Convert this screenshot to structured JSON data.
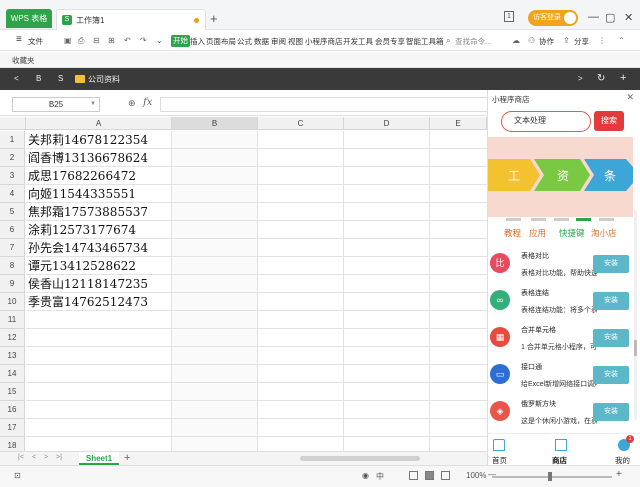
{
  "titlebar": {
    "wps_tab": "WPS 表格",
    "doc_tab": "工作簿1",
    "doc_icon": "S",
    "new_tab": "+",
    "layout_icon": "1",
    "login": "访客登录",
    "minimize": "—",
    "restore": "▢",
    "close": "✕"
  },
  "menubar": {
    "hamburger": "≡",
    "file": "文件",
    "items": [
      "开始",
      "插入",
      "页面布局",
      "公式",
      "数据",
      "审阅",
      "视图",
      "小程序商店",
      "开发工具",
      "会员专享",
      "智能工具箱"
    ],
    "search": "查找命令...",
    "collab": "协作",
    "share": "分享"
  },
  "favbar": {
    "label": "收藏夹"
  },
  "cloudbar": {
    "back": "<",
    "b": "B",
    "s": "S",
    "folder": "公司资料",
    "forward": ">",
    "refresh": "↻",
    "add": "+"
  },
  "formulabar": {
    "cell_ref": "B25",
    "fx": "fx"
  },
  "grid": {
    "columns": [
      "A",
      "B",
      "C",
      "D",
      "E"
    ],
    "rows": [
      "1",
      "2",
      "3",
      "4",
      "5",
      "6",
      "7",
      "8",
      "9",
      "10",
      "11",
      "12",
      "13",
      "14",
      "15",
      "16",
      "17",
      "18"
    ],
    "colA": [
      "关邦莉14678122354",
      "阎香博13136678624",
      "成思17682266472",
      "向姬11544335551",
      "焦邦霜17573885537",
      "涂莉12573177674",
      "孙先会14743465734",
      "谭元13412528622",
      "侯香山12118147235",
      "季贵富14762512473"
    ]
  },
  "sheetbar": {
    "sheet1": "Sheet1",
    "add": "+"
  },
  "statusbar": {
    "zoom": "100%",
    "minus": "—",
    "plus": "+"
  },
  "panel": {
    "title": "小程序商店",
    "close": "✕",
    "search_value": "文本处理",
    "search_button": "搜索",
    "banner": [
      "工",
      "资",
      "条"
    ],
    "categories": [
      "教程",
      "应用",
      "快捷键",
      "淘小店"
    ],
    "apps": [
      {
        "name": "表格对比",
        "desc": "表格对比功能，帮助快速",
        "install": "安装",
        "color": "#e84a5f",
        "glyph": "比"
      },
      {
        "name": "表格连结",
        "desc": "表格连结功能：将多个表",
        "install": "安装",
        "color": "#33b07a",
        "glyph": "∞"
      },
      {
        "name": "合并单元格",
        "desc": "1 合并单元格小程序，可",
        "install": "安装",
        "color": "#e84a3f",
        "glyph": "▦"
      },
      {
        "name": "接口通",
        "desc": "给Excel新增网络接口调用",
        "install": "安装",
        "color": "#2b6fd6",
        "glyph": "▭"
      },
      {
        "name": "俄罗斯方块",
        "desc": "这是个休闲小游戏，在表格",
        "install": "安装",
        "color": "#e8564a",
        "glyph": "◈"
      }
    ],
    "nav": [
      "首页",
      "商店",
      "我的"
    ],
    "badge": "1"
  },
  "colors": {
    "accent": "#2fa34a",
    "login": "#f0a41c",
    "danger": "#e23b3b",
    "install": "#5cb8c9"
  }
}
